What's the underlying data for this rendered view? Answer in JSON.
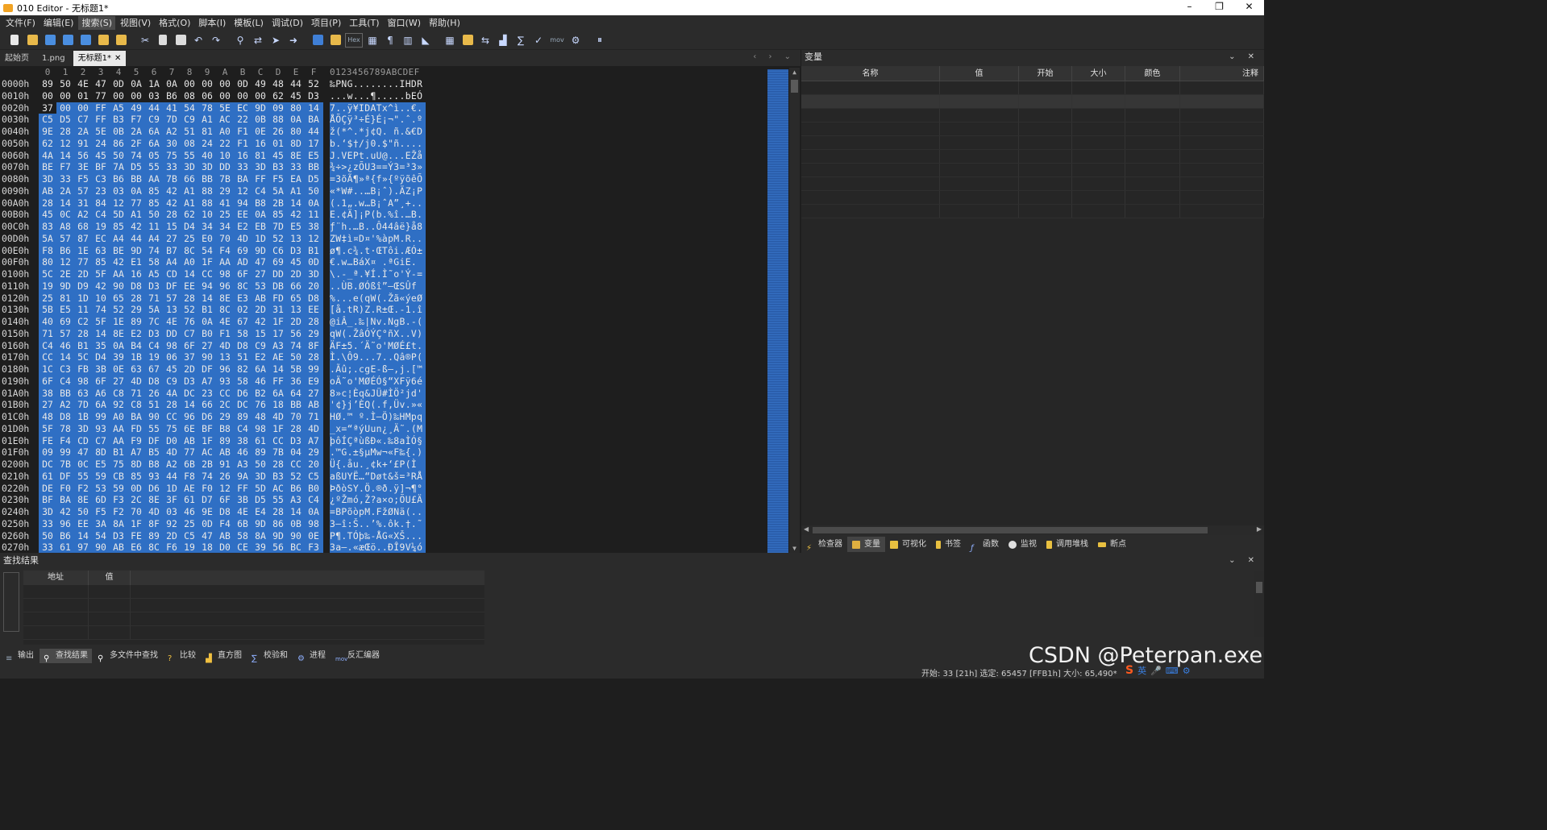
{
  "window": {
    "title": "010 Editor - 无标题1*",
    "minimize": "–",
    "maximize": "❐",
    "close": "✕"
  },
  "menu": [
    "文件(F)",
    "编辑(E)",
    "搜索(S)",
    "视图(V)",
    "格式(O)",
    "脚本(I)",
    "模板(L)",
    "调试(D)",
    "项目(P)",
    "工具(T)",
    "窗口(W)",
    "帮助(H)"
  ],
  "toolbar": {
    "hex_label": "Hex",
    "mov_label": "mov"
  },
  "tabs": [
    {
      "label": "起始页"
    },
    {
      "label": "1.png"
    },
    {
      "label": "无标题1*",
      "close": "✕"
    }
  ],
  "tab_nav": "‹ › ⌄",
  "hex": {
    "column_headers": [
      "0",
      "1",
      "2",
      "3",
      "4",
      "5",
      "6",
      "7",
      "8",
      "9",
      "A",
      "B",
      "C",
      "D",
      "E",
      "F"
    ],
    "ascii_header": "0123456789ABCDEF",
    "rows": [
      {
        "addr": "0000h",
        "bytes": [
          "89",
          "50",
          "4E",
          "47",
          "0D",
          "0A",
          "1A",
          "0A",
          "00",
          "00",
          "00",
          "0D",
          "49",
          "48",
          "44",
          "52"
        ],
        "ascii": "‰PNG........IHDR"
      },
      {
        "addr": "0010h",
        "bytes": [
          "00",
          "00",
          "01",
          "77",
          "00",
          "00",
          "03",
          "B6",
          "08",
          "06",
          "00",
          "00",
          "00",
          "62",
          "45",
          "D3"
        ],
        "ascii": "...w...¶.....bEÓ"
      },
      {
        "addr": "0020h",
        "bytes": [
          "37",
          "00",
          "00",
          "FF",
          "A5",
          "49",
          "44",
          "41",
          "54",
          "78",
          "5E",
          "EC",
          "9D",
          "09",
          "80",
          "14"
        ],
        "ascii": "7..ÿ¥IDATx^ì..€."
      },
      {
        "addr": "0030h",
        "bytes": [
          "C5",
          "D5",
          "C7",
          "FF",
          "B3",
          "F7",
          "C9",
          "7D",
          "C9",
          "A1",
          "AC",
          "22",
          "0B",
          "88",
          "0A",
          "BA"
        ],
        "ascii": "ÅÕÇÿ³÷É}É¡¬\".ˆ.º"
      },
      {
        "addr": "0040h",
        "bytes": [
          "9E",
          "28",
          "2A",
          "5E",
          "0B",
          "2A",
          "6A",
          "A2",
          "51",
          "81",
          "A0",
          "F1",
          "0E",
          "26",
          "80",
          "44"
        ],
        "ascii": "ž(*^.*j¢Q. ñ.&€D"
      },
      {
        "addr": "0050h",
        "bytes": [
          "62",
          "12",
          "91",
          "24",
          "86",
          "2F",
          "6A",
          "30",
          "08",
          "24",
          "22",
          "F1",
          "16",
          "01",
          "8D",
          "17"
        ],
        "ascii": "b.‘$†/j0.$\"ñ...."
      },
      {
        "addr": "0060h",
        "bytes": [
          "4A",
          "14",
          "56",
          "45",
          "50",
          "74",
          "05",
          "75",
          "55",
          "40",
          "10",
          "16",
          "81",
          "45",
          "8E",
          "E5"
        ],
        "ascii": "J.VEPt.uU@...EŽå"
      },
      {
        "addr": "0070h",
        "bytes": [
          "BE",
          "F7",
          "3E",
          "BF",
          "7A",
          "D5",
          "55",
          "33",
          "3D",
          "3D",
          "DD",
          "33",
          "3D",
          "B3",
          "33",
          "BB"
        ],
        "ascii": "¾÷>¿zÕU3==Ý3=³3»"
      },
      {
        "addr": "0080h",
        "bytes": [
          "3D",
          "33",
          "F5",
          "C3",
          "B6",
          "BB",
          "AA",
          "7B",
          "66",
          "BB",
          "7B",
          "BA",
          "FF",
          "F5",
          "EA",
          "D5"
        ],
        "ascii": "=3õÃ¶»ª{f»{ºÿõêÕ"
      },
      {
        "addr": "0090h",
        "bytes": [
          "AB",
          "2A",
          "57",
          "23",
          "03",
          "0A",
          "85",
          "42",
          "A1",
          "88",
          "29",
          "12",
          "C4",
          "5A",
          "A1",
          "50"
        ],
        "ascii": "«*W#..…B¡ˆ).ÄZ¡P"
      },
      {
        "addr": "00A0h",
        "bytes": [
          "28",
          "14",
          "31",
          "84",
          "12",
          "77",
          "85",
          "42",
          "A1",
          "88",
          "41",
          "94",
          "B8",
          "2B",
          "14",
          "0A"
        ],
        "ascii": "(.1„.w…B¡ˆA”¸+.."
      },
      {
        "addr": "00B0h",
        "bytes": [
          "45",
          "0C",
          "A2",
          "C4",
          "5D",
          "A1",
          "50",
          "28",
          "62",
          "10",
          "25",
          "EE",
          "0A",
          "85",
          "42",
          "11"
        ],
        "ascii": "E.¢Ä]¡P(b.%î.…B."
      },
      {
        "addr": "00C0h",
        "bytes": [
          "83",
          "A8",
          "68",
          "19",
          "85",
          "42",
          "11",
          "15",
          "D4",
          "34",
          "34",
          "E2",
          "EB",
          "7D",
          "E5",
          "38"
        ],
        "ascii": "ƒ¨h.…B..Ô44âë}å8"
      },
      {
        "addr": "00D0h",
        "bytes": [
          "5A",
          "57",
          "87",
          "EC",
          "A4",
          "44",
          "A4",
          "27",
          "25",
          "E0",
          "70",
          "4D",
          "1D",
          "52",
          "13",
          "12"
        ],
        "ascii": "ZW‡ì¤D¤'%àpM.R.."
      },
      {
        "addr": "00E0h",
        "bytes": [
          "F8",
          "B6",
          "1E",
          "63",
          "BE",
          "9D",
          "74",
          "B7",
          "8C",
          "54",
          "F4",
          "69",
          "9D",
          "C6",
          "D3",
          "B1"
        ],
        "ascii": "ø¶.c¾.t·ŒTôi.ÆÓ±"
      },
      {
        "addr": "00F0h",
        "bytes": [
          "80",
          "12",
          "77",
          "85",
          "42",
          "E1",
          "58",
          "A4",
          "A0",
          "1F",
          "AA",
          "AD",
          "47",
          "69",
          "45",
          "0D"
        ],
        "ascii": "€.w…BáX¤ .ª­GiE."
      },
      {
        "addr": "0100h",
        "bytes": [
          "5C",
          "2E",
          "2D",
          "5F",
          "AA",
          "16",
          "A5",
          "CD",
          "14",
          "CC",
          "98",
          "6F",
          "27",
          "DD",
          "2D",
          "3D"
        ],
        "ascii": "\\.-_ª.¥Í.Ì˜o'Ý-="
      },
      {
        "addr": "0110h",
        "bytes": [
          "19",
          "9D",
          "D9",
          "42",
          "90",
          "D8",
          "D3",
          "DF",
          "EE",
          "94",
          "96",
          "8C",
          "53",
          "DB",
          "66",
          "20"
        ],
        "ascii": "..ÙB.ØÓßî”–ŒSÛf "
      },
      {
        "addr": "0120h",
        "bytes": [
          "25",
          "81",
          "1D",
          "10",
          "65",
          "28",
          "71",
          "57",
          "28",
          "14",
          "8E",
          "E3",
          "AB",
          "FD",
          "65",
          "D8"
        ],
        "ascii": "%...e(qW(.Žã«ýeØ"
      },
      {
        "addr": "0130h",
        "bytes": [
          "5B",
          "E5",
          "11",
          "74",
          "52",
          "29",
          "5A",
          "13",
          "52",
          "B1",
          "8C",
          "02",
          "2D",
          "31",
          "13",
          "EE"
        ],
        "ascii": "[å.tR)Z.R±Œ.-1.î"
      },
      {
        "addr": "0140h",
        "bytes": [
          "40",
          "69",
          "C2",
          "5F",
          "1E",
          "89",
          "7C",
          "4E",
          "76",
          "0A",
          "4E",
          "67",
          "42",
          "1F",
          "2D",
          "28"
        ],
        "ascii": "@iÂ_.‰|Nv.NgB.-("
      },
      {
        "addr": "0150h",
        "bytes": [
          "71",
          "57",
          "28",
          "14",
          "8E",
          "E2",
          "D3",
          "DD",
          "C7",
          "B0",
          "F1",
          "58",
          "15",
          "17",
          "56",
          "29"
        ],
        "ascii": "qW(.ŽâÓÝÇ°ñX..V)"
      },
      {
        "addr": "0160h",
        "bytes": [
          "C4",
          "46",
          "B1",
          "35",
          "0A",
          "B4",
          "C4",
          "98",
          "6F",
          "27",
          "4D",
          "D8",
          "C9",
          "A3",
          "74",
          "8F"
        ],
        "ascii": "ÄF±5.´Ä˜o'MØÉ£t."
      },
      {
        "addr": "0170h",
        "bytes": [
          "CC",
          "14",
          "5C",
          "D4",
          "39",
          "1B",
          "19",
          "06",
          "37",
          "90",
          "13",
          "51",
          "E2",
          "AE",
          "50",
          "28"
        ],
        "ascii": "Ì.\\Ô9...7..Qâ®P("
      },
      {
        "addr": "0180h",
        "bytes": [
          "1C",
          "C3",
          "FB",
          "3B",
          "0E",
          "63",
          "67",
          "45",
          "2D",
          "DF",
          "96",
          "82",
          "6A",
          "14",
          "5B",
          "99"
        ],
        "ascii": ".Ãû;.cgE-ß–‚j.[™"
      },
      {
        "addr": "0190h",
        "bytes": [
          "6F",
          "C4",
          "98",
          "6F",
          "27",
          "4D",
          "D8",
          "C9",
          "D3",
          "A7",
          "93",
          "58",
          "46",
          "FF",
          "36",
          "E9"
        ],
        "ascii": "oÄ˜o'MØÉÓ§“XFÿ6é"
      },
      {
        "addr": "01A0h",
        "bytes": [
          "38",
          "BB",
          "63",
          "A6",
          "C8",
          "71",
          "26",
          "4A",
          "DC",
          "23",
          "CC",
          "D6",
          "B2",
          "6A",
          "64",
          "27"
        ],
        "ascii": "8»c¦Èq&JÜ#ÌÖ²jd'"
      },
      {
        "addr": "01B0h",
        "bytes": [
          "27",
          "A2",
          "7D",
          "6A",
          "92",
          "C8",
          "51",
          "28",
          "14",
          "66",
          "2C",
          "DC",
          "76",
          "18",
          "BB",
          "AB"
        ],
        "ascii": "'¢}j’ÈQ(.f,Üv.»«"
      },
      {
        "addr": "01C0h",
        "bytes": [
          "48",
          "D8",
          "1B",
          "99",
          "A0",
          "BA",
          "90",
          "CC",
          "96",
          "D6",
          "29",
          "89",
          "48",
          "4D",
          "70",
          "71"
        ],
        "ascii": "HØ.™ º.Ì–Ö)‰HMpq"
      },
      {
        "addr": "01D0h",
        "bytes": [
          "5F",
          "78",
          "3D",
          "93",
          "AA",
          "FD",
          "55",
          "75",
          "6E",
          "BF",
          "B8",
          "C4",
          "98",
          "1F",
          "28",
          "4D"
        ],
        "ascii": "_x=“ªýUun¿¸Ä˜.(M"
      },
      {
        "addr": "01E0h",
        "bytes": [
          "FE",
          "F4",
          "CD",
          "C7",
          "AA",
          "F9",
          "DF",
          "D0",
          "AB",
          "1F",
          "89",
          "38",
          "61",
          "CC",
          "D3",
          "A7"
        ],
        "ascii": "þôÍÇªùßÐ«.‰8aÌÓ§"
      },
      {
        "addr": "01F0h",
        "bytes": [
          "09",
          "99",
          "47",
          "8D",
          "B1",
          "A7",
          "B5",
          "4D",
          "77",
          "AC",
          "AB",
          "46",
          "89",
          "7B",
          "04",
          "29"
        ],
        "ascii": ".™G.±§µMw¬«F‰{.)"
      },
      {
        "addr": "0200h",
        "bytes": [
          "DC",
          "7B",
          "0C",
          "E5",
          "75",
          "8D",
          "B8",
          "A2",
          "6B",
          "2B",
          "91",
          "A3",
          "50",
          "28",
          "CC",
          "20"
        ],
        "ascii": "Ü{.åu.¸¢k+‘£P(Ì "
      },
      {
        "addr": "0210h",
        "bytes": [
          "61",
          "DF",
          "55",
          "59",
          "CB",
          "85",
          "93",
          "44",
          "F8",
          "74",
          "26",
          "9A",
          "3D",
          "B3",
          "52",
          "C5"
        ],
        "ascii": "aßUYË…“Døt&š=³RÅ"
      },
      {
        "addr": "0220h",
        "bytes": [
          "DE",
          "F0",
          "F2",
          "53",
          "59",
          "0D",
          "D6",
          "1D",
          "AE",
          "F0",
          "12",
          "FF",
          "5D",
          "AC",
          "B6",
          "B0"
        ],
        "ascii": "ÞðòSY.Ö.®ð.ÿ]¬¶°"
      },
      {
        "addr": "0230h",
        "bytes": [
          "BF",
          "BA",
          "8E",
          "6D",
          "F3",
          "2C",
          "8E",
          "3F",
          "61",
          "D7",
          "6F",
          "3B",
          "D5",
          "55",
          "A3",
          "C4"
        ],
        "ascii": "¿ºŽmó,Ž?a×o;ÕU£Ä"
      },
      {
        "addr": "0240h",
        "bytes": [
          "3D",
          "42",
          "50",
          "F5",
          "F2",
          "70",
          "4D",
          "03",
          "46",
          "9E",
          "D8",
          "4E",
          "E4",
          "28",
          "14",
          "0A"
        ],
        "ascii": "=BPõòpM.FžØNä(.."
      },
      {
        "addr": "0250h",
        "bytes": [
          "33",
          "96",
          "EE",
          "3A",
          "8A",
          "1F",
          "8F",
          "92",
          "25",
          "0D",
          "F4",
          "6B",
          "9D",
          "86",
          "0B",
          "98"
        ],
        "ascii": "3–î:Š..’%.ôk.†.˜"
      },
      {
        "addr": "0260h",
        "bytes": [
          "50",
          "B6",
          "14",
          "54",
          "D3",
          "FE",
          "89",
          "2D",
          "C5",
          "47",
          "AB",
          "58",
          "8A",
          "9D",
          "90",
          "0E"
        ],
        "ascii": "P¶.TÓþ‰-ÅG«XŠ..."
      },
      {
        "addr": "0270h",
        "bytes": [
          "33",
          "61",
          "97",
          "90",
          "AB",
          "E6",
          "8C",
          "F6",
          "19",
          "18",
          "D0",
          "CE",
          "39",
          "56",
          "BC",
          "F3"
        ],
        "ascii": "3a—.«æŒö..ÐÎ9V¼ó"
      }
    ]
  },
  "variables_panel": {
    "title": "变量",
    "columns": [
      "名称",
      "值",
      "开始",
      "大小",
      "颜色",
      "注释"
    ],
    "tabs": [
      "检查器",
      "变量",
      "可视化",
      "书签",
      "函数",
      "监视",
      "调用堆栈",
      "断点"
    ]
  },
  "find_panel": {
    "title": "查找结果",
    "columns": [
      "地址",
      "值"
    ]
  },
  "bottom_tabs": [
    "输出",
    "查找结果",
    "多文件中查找",
    "比较",
    "直方图",
    "校验和",
    "进程",
    "反汇编器"
  ],
  "status": {
    "text": "开始: 33 [21h]   选定: 65457 [FFB1h]   大小: 65,490*"
  },
  "ime": {
    "logo": "S",
    "lang": "英"
  },
  "watermark": "CSDN @Peterpan.exe",
  "colors": {
    "selection": "#2f6fc4",
    "background": "#1e1e1e",
    "panel": "#2b2b2b"
  }
}
